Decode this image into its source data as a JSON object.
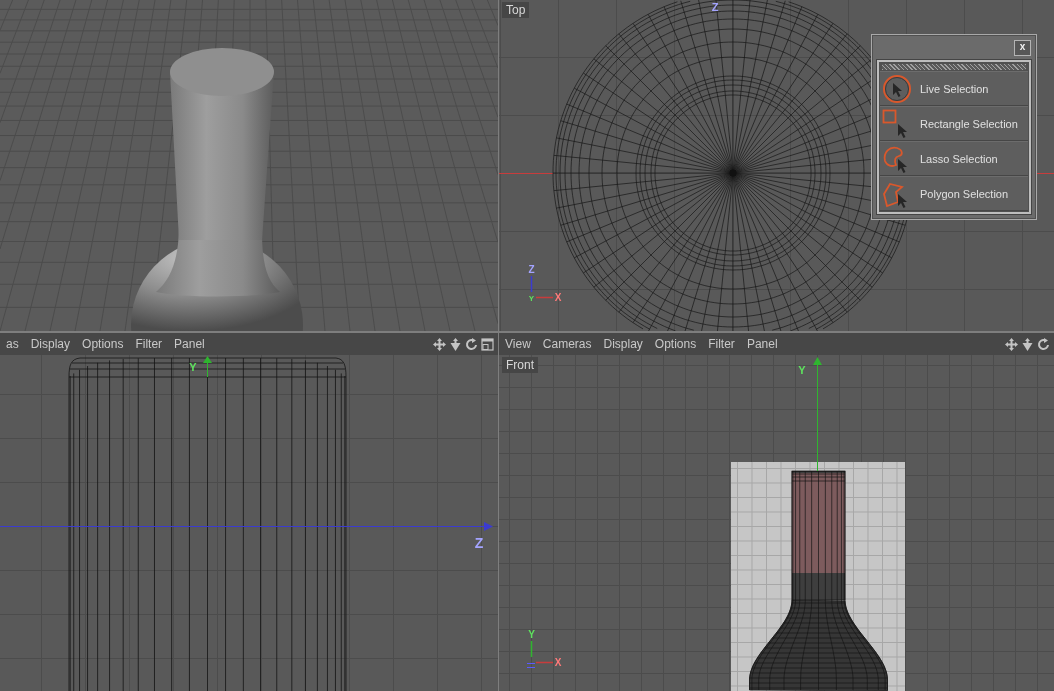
{
  "viewports": [
    {
      "kind": "perspective"
    },
    {
      "kind": "top",
      "label": "Top",
      "axis_labels": {
        "vertical": "Z"
      },
      "gizmo": {
        "up": "Z",
        "origin": "Y",
        "right": "X"
      }
    },
    {
      "kind": "right",
      "menu": [
        "as",
        "Display",
        "Options",
        "Filter",
        "Panel"
      ],
      "toolbar": [
        {
          "kind": "move"
        },
        {
          "kind": "dolly"
        },
        {
          "kind": "rotate"
        },
        {
          "kind": "maximize"
        }
      ],
      "axis_labels": {
        "vertical": "Y",
        "horizontal": "Z"
      }
    },
    {
      "kind": "front",
      "menu": [
        "View",
        "Cameras",
        "Display",
        "Options",
        "Filter",
        "Panel"
      ],
      "toolbar": [
        {
          "kind": "move"
        },
        {
          "kind": "dolly"
        },
        {
          "kind": "rotate"
        }
      ],
      "label": "Front",
      "axis_labels": {
        "vertical": "Y"
      },
      "gizmo": {
        "up": "Y",
        "right": "X"
      }
    }
  ],
  "selection_palette": {
    "close": "x",
    "items": [
      {
        "kind": "live",
        "label": "Live Selection"
      },
      {
        "kind": "rectangle",
        "label": "Rectangle Selection"
      },
      {
        "kind": "lasso",
        "label": "Lasso Selection"
      },
      {
        "kind": "polygon",
        "label": "Polygon Selection"
      }
    ]
  }
}
